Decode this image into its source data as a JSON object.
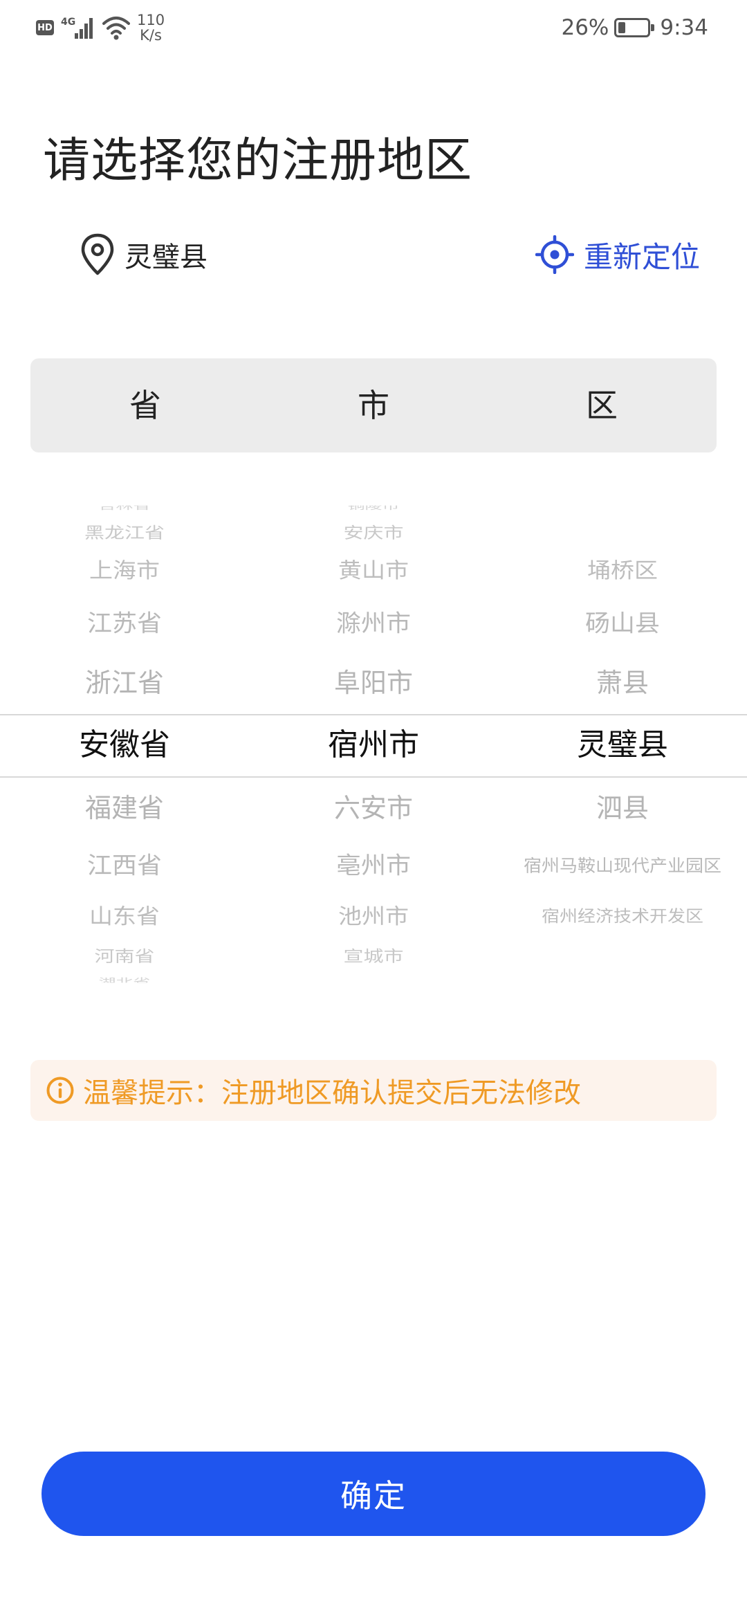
{
  "status_bar": {
    "hd": "HD",
    "network": "4G",
    "speed_value": "110",
    "speed_unit": "K/s",
    "battery": "26%",
    "battery_level": 0.26,
    "time": "9:34"
  },
  "title": "请选择您的注册地区",
  "location": {
    "current": "灵璧县",
    "relocate_label": "重新定位"
  },
  "picker_header": {
    "province": "省",
    "city": "市",
    "district": "区"
  },
  "picker": {
    "provinces": [
      "吉林省",
      "黑龙江省",
      "上海市",
      "江苏省",
      "浙江省",
      "安徽省",
      "福建省",
      "江西省",
      "山东省",
      "河南省",
      "湖北省"
    ],
    "cities": [
      "铜陵市",
      "安庆市",
      "黄山市",
      "滁州市",
      "阜阳市",
      "宿州市",
      "六安市",
      "亳州市",
      "池州市",
      "宣城市"
    ],
    "districts": [
      "埇桥区",
      "砀山县",
      "萧县",
      "灵璧县",
      "泗县",
      "宿州马鞍山现代产业园区",
      "宿州经济技术开发区"
    ],
    "selected_province": "安徽省",
    "selected_city": "宿州市",
    "selected_district": "灵璧县"
  },
  "tip": "温馨提示：注册地区确认提交后无法修改",
  "confirm_label": "确定",
  "colors": {
    "accent": "#1f55ee",
    "relocate": "#2f4fd6",
    "tip_text": "#ef9a25",
    "tip_bg": "#fdf3ec"
  }
}
